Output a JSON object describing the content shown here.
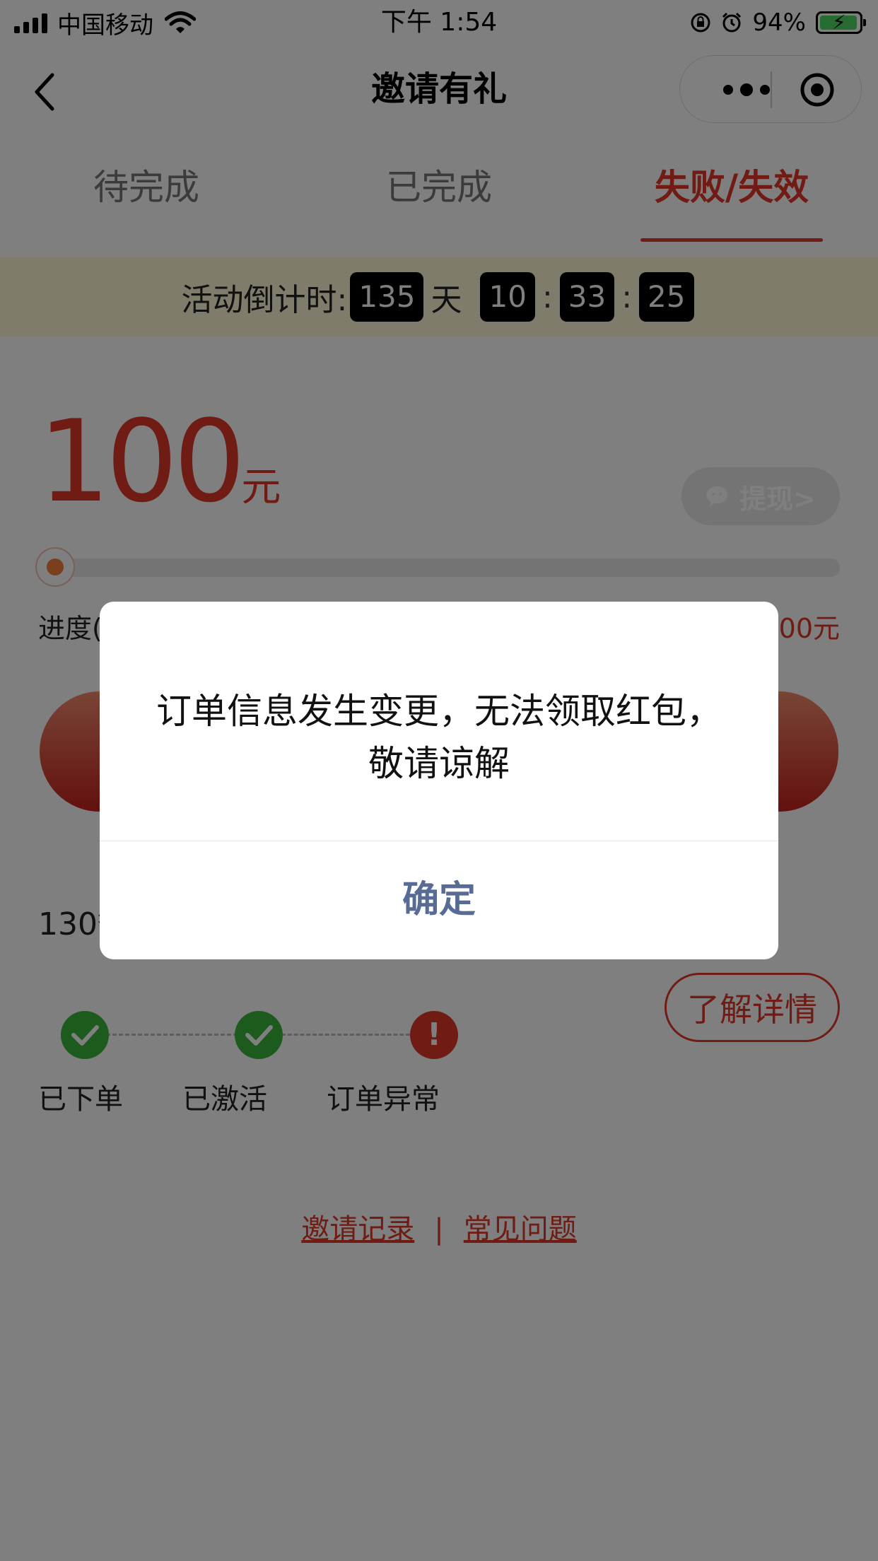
{
  "status_bar": {
    "carrier": "中国移动",
    "time": "下午 1:54",
    "battery": "94%"
  },
  "nav": {
    "title": "邀请有礼"
  },
  "tabs": [
    {
      "label": "待完成"
    },
    {
      "label": "已完成"
    },
    {
      "label": "失败/失效"
    }
  ],
  "countdown": {
    "label": "活动倒计时:",
    "days": "135",
    "day_unit": "天",
    "hours": "10",
    "minutes": "33",
    "seconds": "25",
    "sep": ":"
  },
  "reward": {
    "amount": "100",
    "unit": "元",
    "withdraw_label": "提现>"
  },
  "progress": {
    "left_text": "进度(",
    "right_text": "00元"
  },
  "phone_fragment": "130*",
  "detail_button": "了解详情",
  "steps": [
    {
      "label": "已下单",
      "status": "done"
    },
    {
      "label": "已激活",
      "status": "done"
    },
    {
      "label": "订单异常",
      "status": "error",
      "mark": "!"
    }
  ],
  "links": {
    "records": "邀请记录",
    "separator": "|",
    "faq": "常见问题"
  },
  "dialog": {
    "message": "订单信息发生变更，无法领取红包，敬请谅解",
    "confirm": "确定"
  },
  "colors": {
    "accent_red": "#e0392b",
    "success_green": "#3bb53a",
    "dialog_button": "#576b95",
    "banner_bg": "#fff9d6"
  }
}
